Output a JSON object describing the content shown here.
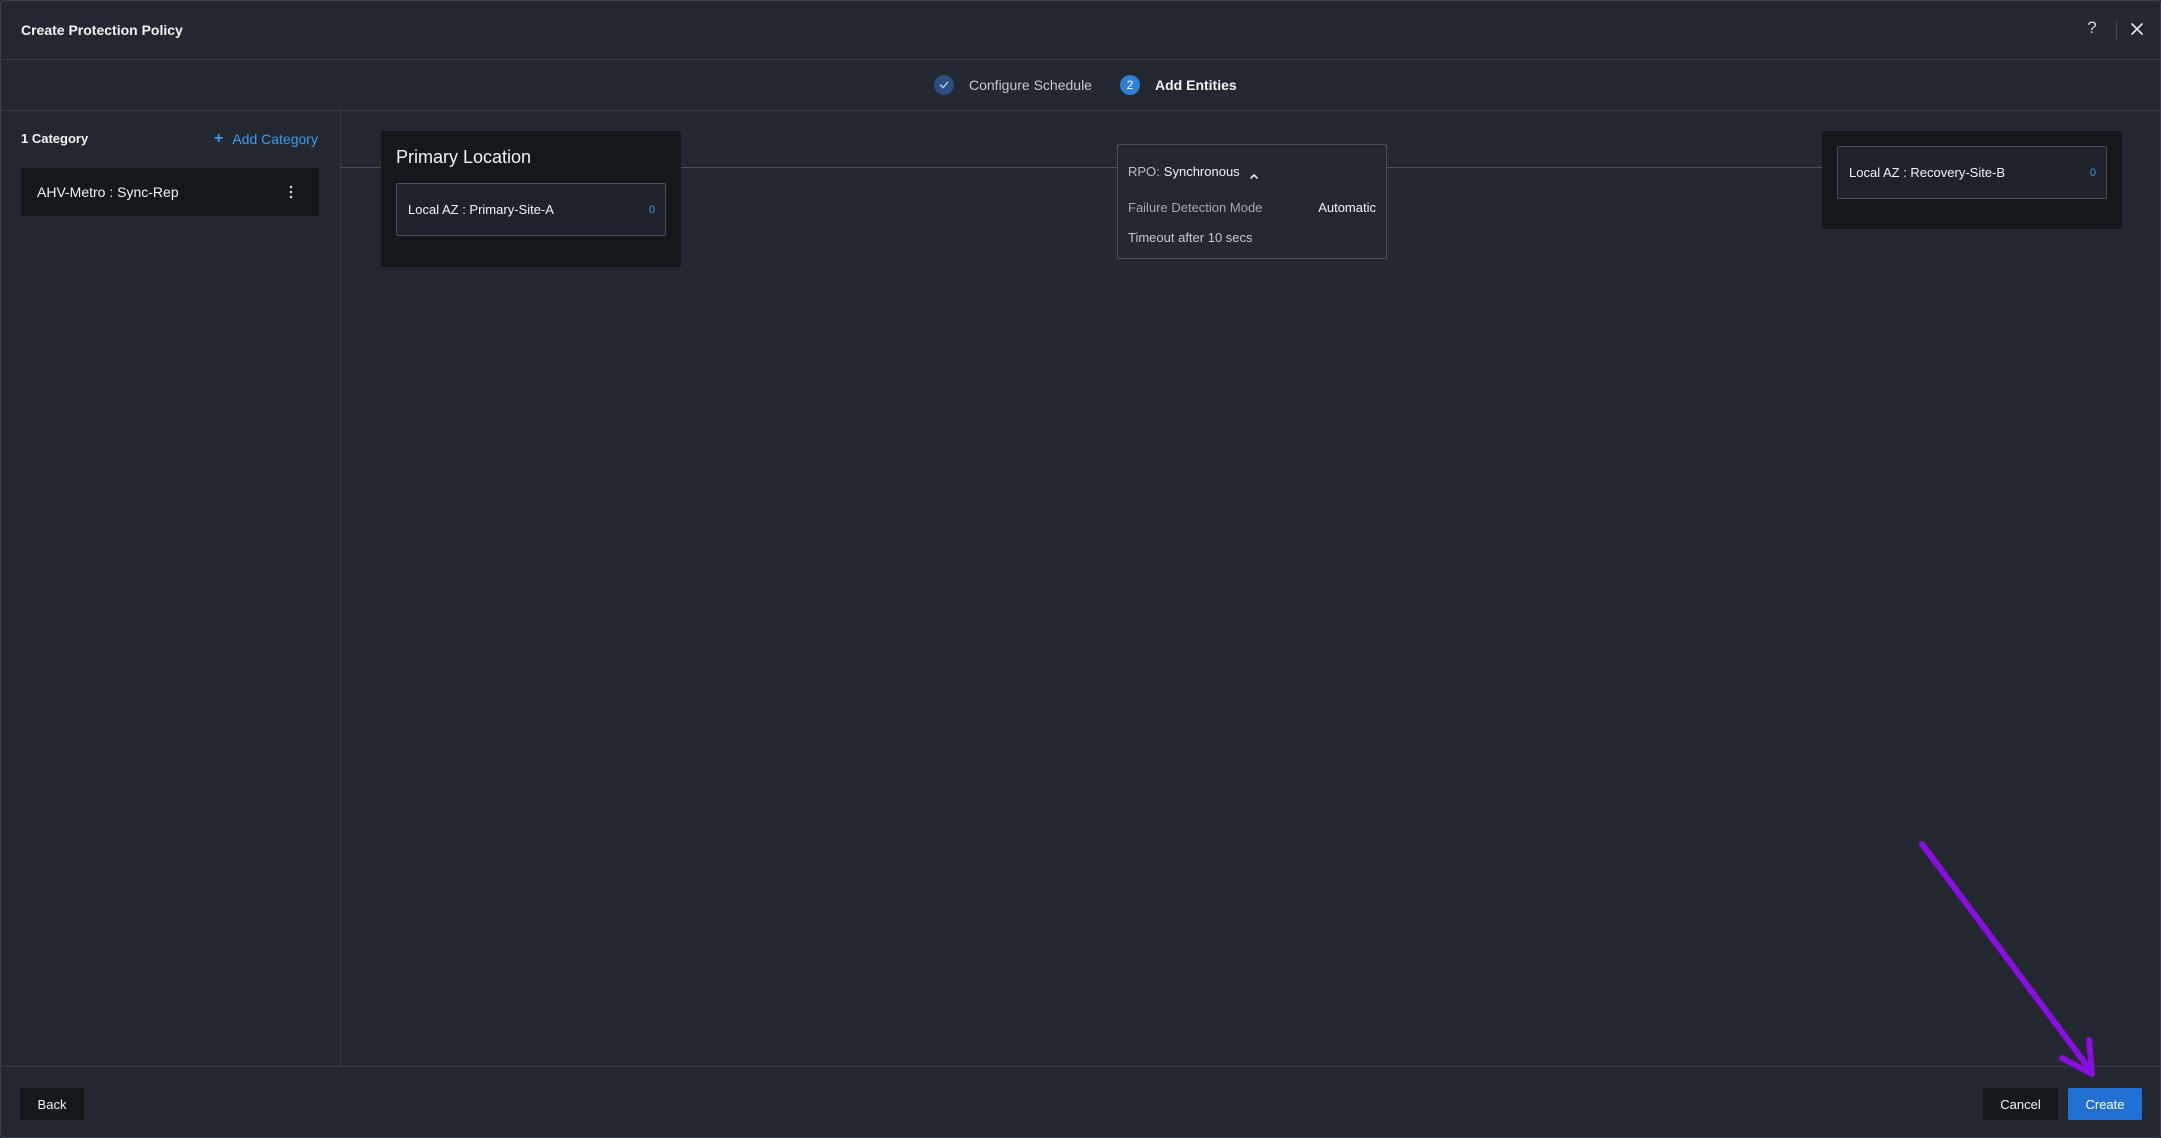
{
  "dialog": {
    "title": "Create Protection Policy",
    "help_icon": "help-icon",
    "help_glyph": "?",
    "close_icon": "close-icon"
  },
  "steps": [
    {
      "label": "Configure Schedule",
      "state": "complete",
      "icon": "check-icon"
    },
    {
      "label": "Add Entities",
      "state": "active",
      "number": "2"
    }
  ],
  "sidebar": {
    "count_label": "1 Category",
    "add_label": "Add Category",
    "add_glyph": "+",
    "categories": [
      {
        "label": "AHV-Metro : Sync-Rep",
        "menu_icon": "kebab-menu-icon"
      }
    ]
  },
  "primary": {
    "title": "Primary Location",
    "site": "Local AZ : Primary-Site-A",
    "count": "0"
  },
  "rpo": {
    "key": "RPO:",
    "value": "Synchronous",
    "expanded_icon": "chevron-up-icon",
    "failure_label": "Failure Detection Mode",
    "failure_value": "Automatic",
    "timeout": "Timeout after 10 secs"
  },
  "recovery": {
    "site": "Local AZ : Recovery-Site-B",
    "count": "0"
  },
  "footer": {
    "back": "Back",
    "cancel": "Cancel",
    "create": "Create"
  },
  "colors": {
    "background": "#222730",
    "panel": "#14171c",
    "accent": "#2271d2",
    "link": "#3d9cf0",
    "annotation_arrow": "#8a0ee0"
  },
  "annotation": {
    "type": "arrow",
    "target": "create-button"
  }
}
